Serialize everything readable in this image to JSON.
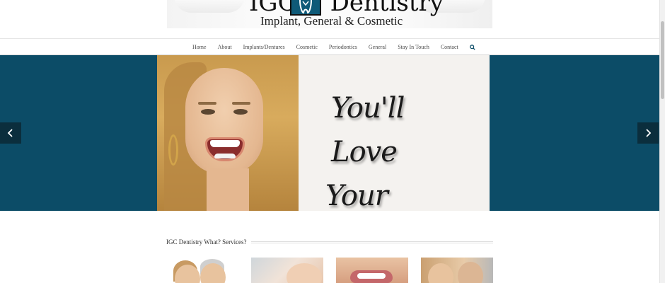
{
  "logo": {
    "title_left": "IGC",
    "title_right": "Dentistry",
    "subtitle": "Implant, General & Cosmetic",
    "mark_icon": "tooth-icon"
  },
  "nav": {
    "items": [
      {
        "label": "Home"
      },
      {
        "label": "About"
      },
      {
        "label": "Implants/Dentures"
      },
      {
        "label": "Cosmetic"
      },
      {
        "label": "Periodontics"
      },
      {
        "label": "General"
      },
      {
        "label": "Stay In Touch"
      },
      {
        "label": "Contact"
      }
    ],
    "search_icon": "search-icon"
  },
  "slider": {
    "line1": "You'll Love",
    "line2": "Your Smile!",
    "prev_icon": "chevron-left-icon",
    "next_icon": "chevron-right-icon"
  },
  "services": {
    "title": "IGC Dentistry What? Services?"
  },
  "colors": {
    "brand": "#0c4c67",
    "arrow_bg": "#0b2e3d",
    "nav_text": "#4a4a4a"
  }
}
